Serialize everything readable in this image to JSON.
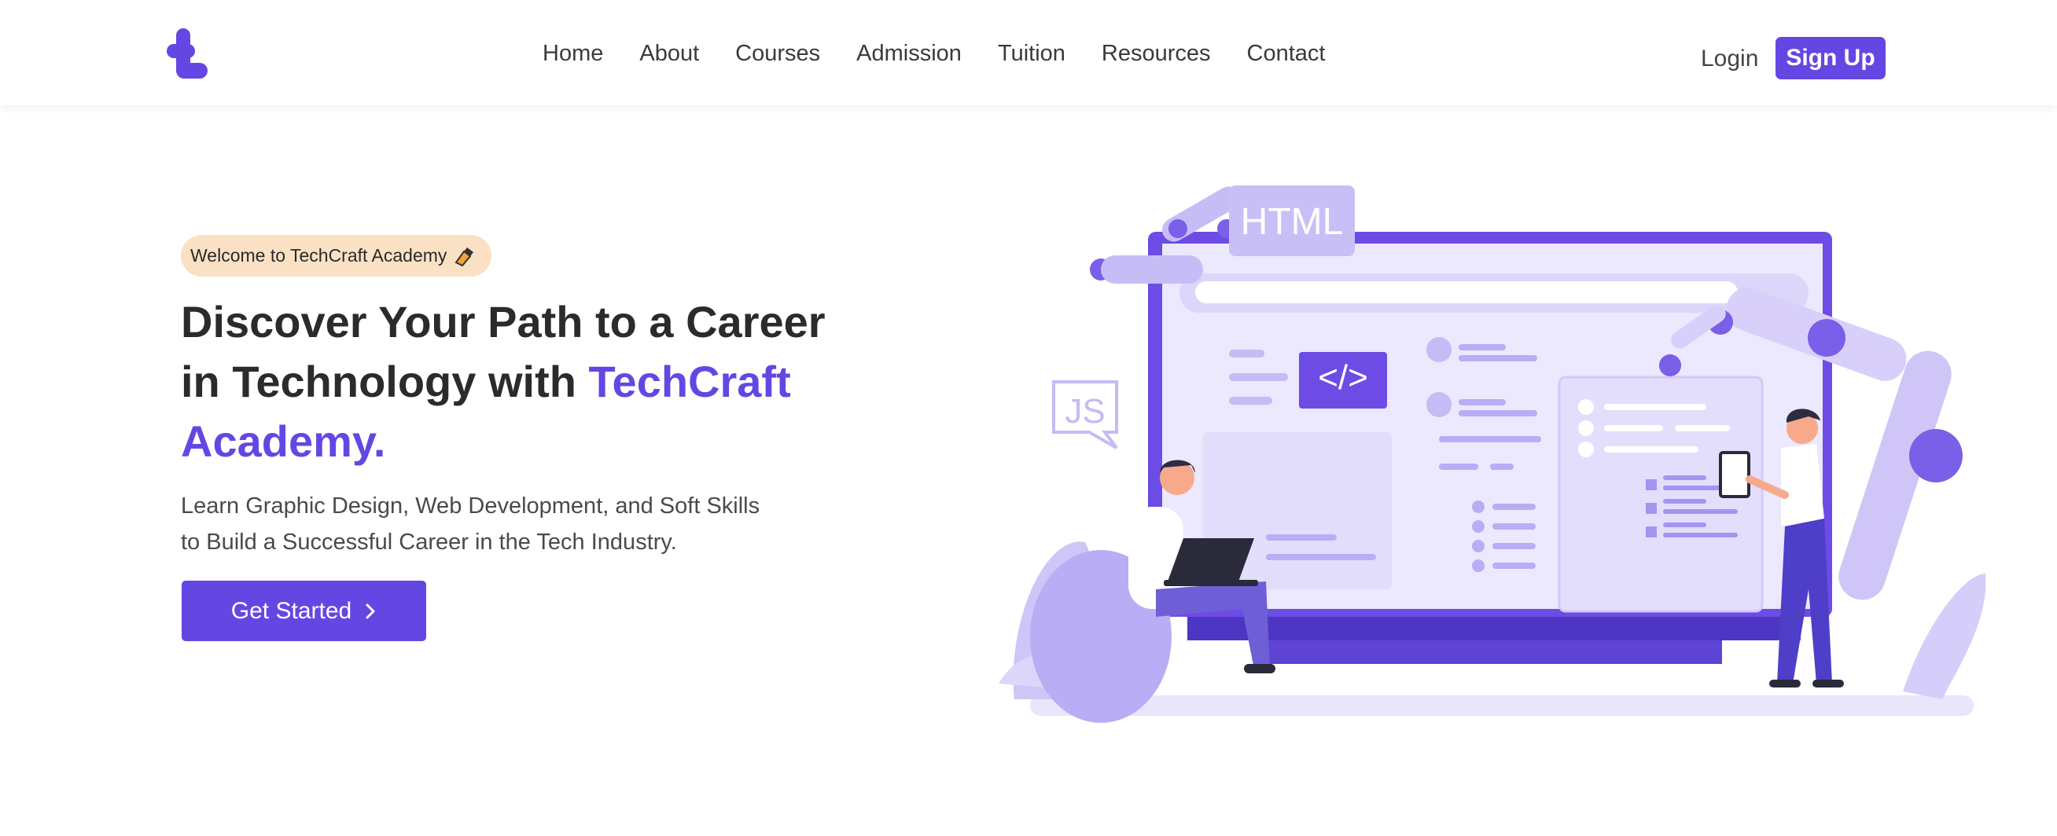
{
  "nav": {
    "logo_icon": "techcraft-logo-icon",
    "links": [
      "Home",
      "About",
      "Courses",
      "Admission",
      "Tuition",
      "Resources",
      "Contact"
    ],
    "login_label": "Login",
    "signup_label": "Sign Up"
  },
  "hero": {
    "badge": "Welcome to TechCraft Academy",
    "badge_icon": "pen-icon",
    "title_part1": "Discover Your Path to a Career in Technology with",
    "title_accent": "TechCraft Academy.",
    "subtitle_line1": "Learn Graphic Design, Web Development, and Soft Skills",
    "subtitle_line2": "to Build a Successful Career in the Tech Industry.",
    "cta_label": "Get Started",
    "cta_icon": "chevron-right-icon"
  },
  "illustration": {
    "html_tag": "HTML",
    "js_tag": "JS",
    "code_tag": "</>"
  },
  "colors": {
    "brand": "#6447e3",
    "badge_bg": "#fbe1c4",
    "illustration_light": "#e8e4fb",
    "illustration_mid": "#b9adf5"
  }
}
